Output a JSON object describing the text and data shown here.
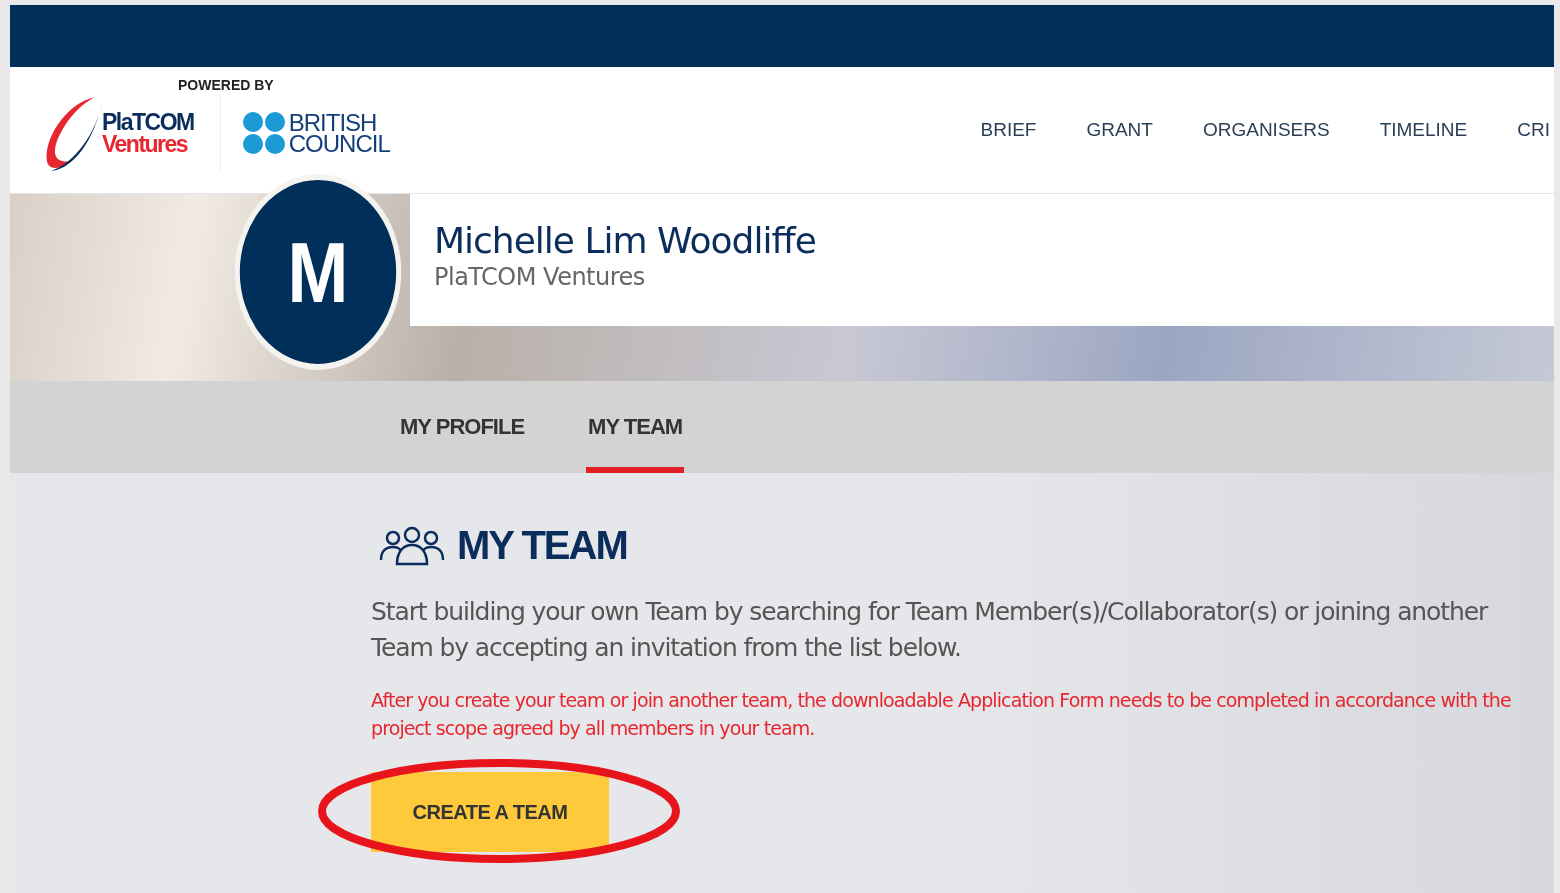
{
  "header": {
    "powered_by": "POWERED BY",
    "logo_primary": {
      "line1": "PlaTCOM",
      "line2": "Ventures"
    },
    "logo_partner": {
      "line1": "BRITISH",
      "line2": "COUNCIL"
    }
  },
  "nav": [
    {
      "label": "BRIEF"
    },
    {
      "label": "GRANT"
    },
    {
      "label": "ORGANISERS"
    },
    {
      "label": "TIMELINE"
    },
    {
      "label": "CRI"
    }
  ],
  "profile": {
    "initial": "M",
    "name": "Michelle Lim Woodliffe",
    "organisation": "PlaTCOM Ventures"
  },
  "tabs": [
    {
      "label": "MY PROFILE",
      "selected": false
    },
    {
      "label": "MY TEAM",
      "selected": true
    }
  ],
  "section": {
    "title": "MY TEAM",
    "intro": "Start building your own Team by searching for Team Member(s)/Collaborator(s) or joining another Team by accepting an invitation from the list below.",
    "notice": "After you create your team or join another team, the downloadable Application Form needs to be completed in accordance with the project scope agreed by all members in your team.",
    "button": "CREATE A TEAM",
    "button_highlighted": true
  }
}
